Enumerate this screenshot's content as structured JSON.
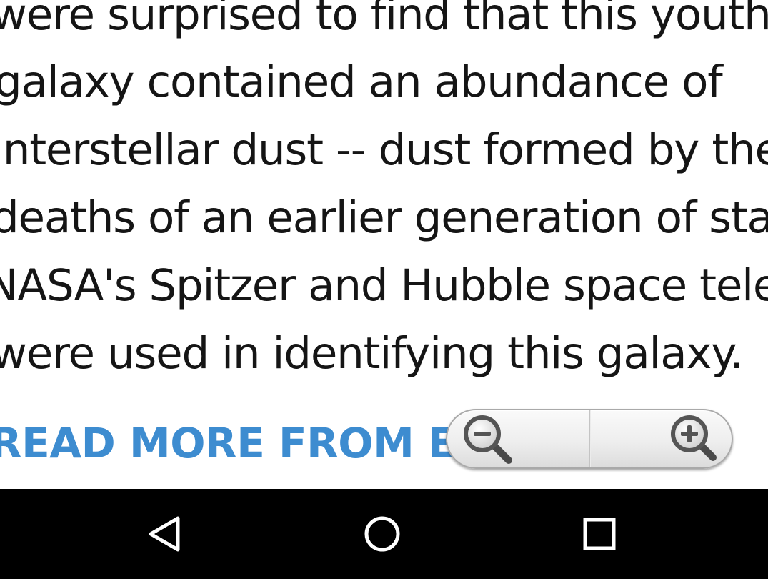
{
  "article": {
    "lines": [
      "were surprised to find that this youthful",
      "galaxy contained an abundance of",
      "interstellar dust -- dust formed by the",
      "deaths of an earlier generation of stars.",
      "NASA's Spitzer and Hubble space telescopes",
      "were used in identifying this galaxy."
    ],
    "read_more": "READ MORE FROM ESO"
  },
  "zoom": {
    "zoom_out_icon": "zoom-out-icon",
    "zoom_in_icon": "zoom-in-icon"
  },
  "navbar": {
    "back_icon": "back-triangle-icon",
    "home_icon": "home-circle-icon",
    "recents_icon": "recents-square-icon"
  },
  "colors": {
    "link": "#3d8cd0",
    "text": "#151515",
    "navbar": "#000000"
  }
}
